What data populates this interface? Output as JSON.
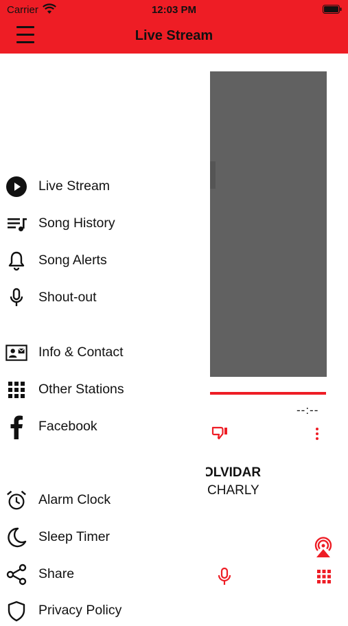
{
  "status_bar": {
    "carrier": "Carrier",
    "time": "12:03 PM"
  },
  "header": {
    "title": "Live Stream"
  },
  "menu": {
    "items": [
      {
        "label": "Live Stream",
        "icon": "play-circle-icon"
      },
      {
        "label": "Song History",
        "icon": "playlist-icon"
      },
      {
        "label": "Song Alerts",
        "icon": "bell-icon"
      },
      {
        "label": "Shout-out",
        "icon": "microphone-icon"
      },
      {
        "label": "Info & Contact",
        "icon": "contact-card-icon"
      },
      {
        "label": "Other Stations",
        "icon": "grid-icon"
      },
      {
        "label": "Facebook",
        "icon": "facebook-icon"
      },
      {
        "label": "Alarm Clock",
        "icon": "alarm-clock-icon"
      },
      {
        "label": "Sleep Timer",
        "icon": "moon-icon"
      },
      {
        "label": "Share",
        "icon": "share-icon"
      },
      {
        "label": "Privacy Policy",
        "icon": "shield-icon"
      }
    ]
  },
  "player": {
    "time_remaining": "--:--",
    "song_title": "OLVIDAR",
    "artist": "CHARLY"
  },
  "colors": {
    "accent": "#ee1d25",
    "artwork": "#616161"
  }
}
